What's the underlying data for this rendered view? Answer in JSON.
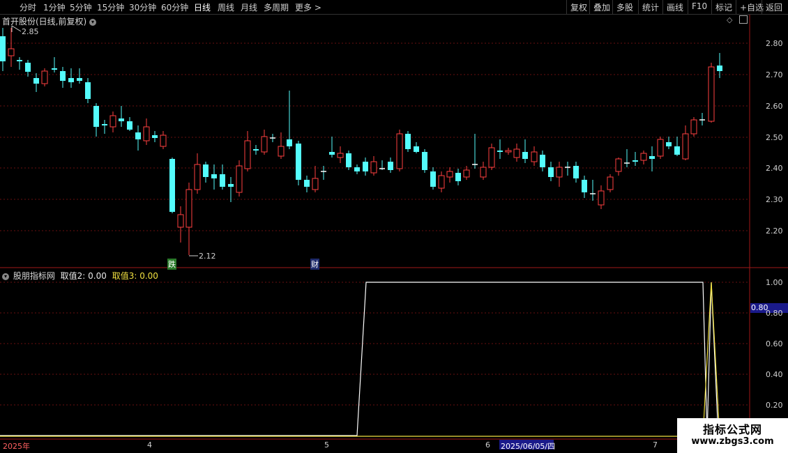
{
  "toolbar": {
    "periods": [
      "分时",
      "1分钟",
      "5分钟",
      "15分钟",
      "30分钟",
      "60分钟",
      "日线",
      "周线",
      "月线",
      "多周期",
      "更多 >"
    ],
    "active_period": "日线",
    "actions": [
      "复权",
      "叠加",
      "多股",
      "统计",
      "画线",
      "F10",
      "标记",
      "+自选",
      "返回"
    ]
  },
  "main_chart": {
    "title": "首开股份(日线,前复权)",
    "high_marker": "2.85",
    "low_marker": "2.12",
    "events": [
      {
        "label": "跌",
        "bg": "#2a7a2a",
        "color": "#ffffff"
      },
      {
        "label": "财",
        "bg": "#1e2a6a",
        "color": "#ffffff"
      }
    ],
    "price_axis": [
      "2.80",
      "2.70",
      "2.60",
      "2.50",
      "2.40",
      "2.30",
      "2.20"
    ],
    "colors": {
      "up": "#ff4040",
      "down": "#54fcfc",
      "grid": "#6a1010",
      "frame": "#a01818"
    }
  },
  "indicator": {
    "name": "股朋指标网",
    "value2_label": "取值2: 0.00",
    "value3_label": "取值3: 0.00",
    "axis": [
      "1.00",
      "0.80",
      "0.60",
      "0.40",
      "0.20"
    ],
    "highlight_value": "0.80"
  },
  "date_axis": {
    "year": "2025年",
    "months": [
      "4",
      "5",
      "6",
      "7"
    ],
    "selected_date": "2025/06/05/四"
  },
  "watermark": {
    "title": "指标公式网",
    "url": "www.zbgs3.com"
  }
}
